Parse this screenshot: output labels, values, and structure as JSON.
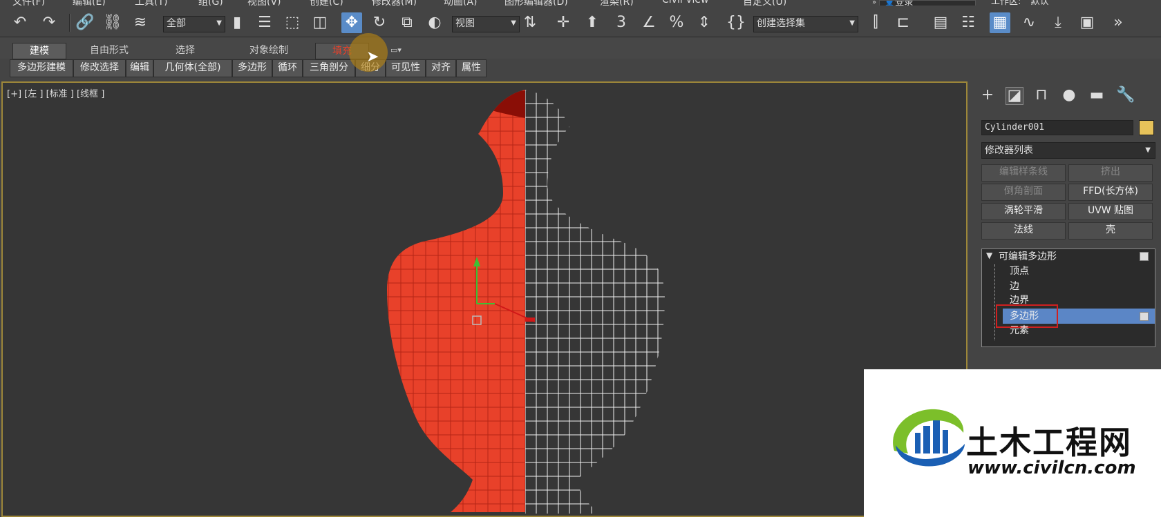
{
  "menu": [
    "文件(F)",
    "编辑(E)",
    "工具(T)",
    "组(G)",
    "视图(V)",
    "创建(C)",
    "修改器(M)",
    "动画(A)",
    "图形编辑器(D)",
    "渲染(R)",
    "Civil View",
    "自定义(U)"
  ],
  "header_right": {
    "login": "登录",
    "workspace_label": "工作区:",
    "workspace_value": "默认"
  },
  "toolbar": {
    "filter_dropdown": "全部",
    "coord_dropdown": "视图",
    "selection_set_dropdown": "创建选择集"
  },
  "ribbon": {
    "tabs": [
      "建模",
      "自由形式",
      "选择",
      "对象绘制",
      "填充"
    ],
    "active_tab": "建模",
    "subtabs": [
      "多边形建模",
      "修改选择",
      "编辑",
      "几何体(全部)",
      "多边形",
      "循环",
      "三角剖分",
      "细分",
      "可见性",
      "对齐",
      "属性"
    ]
  },
  "viewport": {
    "label": "[+] [左 ] [标准 ] [线框 ]",
    "fill_color": "#e8412a"
  },
  "command_panel": {
    "object_name": "Cylinder001",
    "object_color": "#e6c25a",
    "modifier_list_label": "修改器列表",
    "modifier_buttons": [
      {
        "label": "编辑样条线",
        "enabled": false
      },
      {
        "label": "挤出",
        "enabled": false
      },
      {
        "label": "倒角剖面",
        "enabled": false
      },
      {
        "label": "FFD(长方体)",
        "enabled": true
      },
      {
        "label": "涡轮平滑",
        "enabled": true
      },
      {
        "label": "UVW 贴图",
        "enabled": true
      },
      {
        "label": "法线",
        "enabled": true
      },
      {
        "label": "壳",
        "enabled": true
      }
    ],
    "stack": {
      "title": "可编辑多边形",
      "items": [
        "顶点",
        "边",
        "边界",
        "多边形",
        "元素"
      ],
      "selected": "多边形"
    }
  },
  "watermark": {
    "cn": "土木工程网",
    "url": "www.civilcn.com"
  }
}
